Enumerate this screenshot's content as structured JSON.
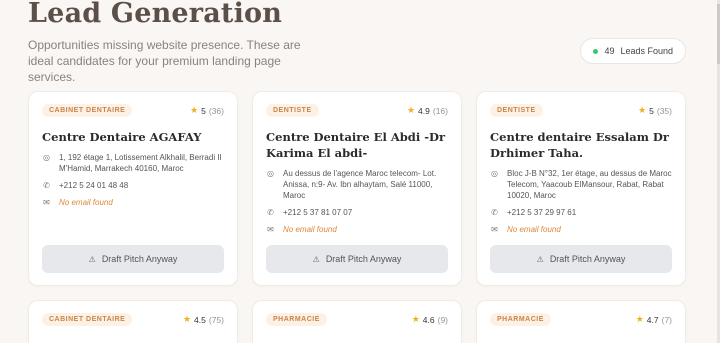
{
  "header": {
    "title": "Lead Generation",
    "subtitle": "Opportunities missing website presence. These are ideal candidates for your premium landing page services.",
    "leads_count": "49",
    "leads_label": "Leads Found"
  },
  "cards": [
    {
      "category": "CABINET DENTAIRE",
      "rating": "5",
      "reviews": "(36)",
      "name": "Centre Dentaire AGAFAY",
      "address": "1, 192 étage 1, Lotissement Alkhalil, Berradi II M'Hamid, Marrakech 40160, Maroc",
      "phone": "+212 5 24 01 48 48",
      "email": "No email found",
      "button": "Draft Pitch Anyway"
    },
    {
      "category": "DENTISTE",
      "rating": "4.9",
      "reviews": "(16)",
      "name": "Centre Dentaire El Abdi -Dr Karima El abdi-",
      "address": "Au dessus de l'agence Maroc telecom- Lot. Anissa, n:9- Av. Ibn alhaytam, Salé 11000, Maroc",
      "phone": "+212 5 37 81 07 07",
      "email": "No email found",
      "button": "Draft Pitch Anyway"
    },
    {
      "category": "DENTISTE",
      "rating": "5",
      "reviews": "(35)",
      "name": "Centre dentaire Essalam Dr Drhimer Taha.",
      "address": "Bloc J-B N°32, 1er étage, au dessus de Maroc Telecom, Yaacoub ElMansour, Rabat, Rabat 10020, Maroc",
      "phone": "+212 5 37 29 97 61",
      "email": "No email found",
      "button": "Draft Pitch Anyway"
    },
    {
      "category": "CABINET DENTAIRE",
      "rating": "4.5",
      "reviews": "(75)"
    },
    {
      "category": "PHARMACIE",
      "rating": "4.6",
      "reviews": "(9)"
    },
    {
      "category": "PHARMACIE",
      "rating": "4.7",
      "reviews": "(7)"
    }
  ],
  "colors": {
    "background": "#faf6f3",
    "accent": "#c8864a",
    "star": "#f2b01e",
    "status_dot": "#3fc36b",
    "email_missing": "#e08a3a"
  }
}
